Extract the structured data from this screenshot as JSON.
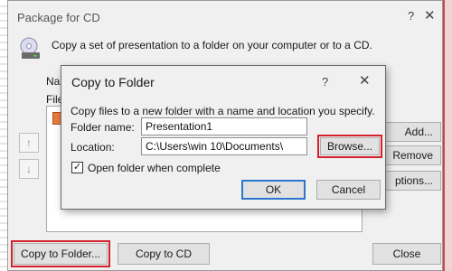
{
  "package_dialog": {
    "title": "Package for CD",
    "help": "?",
    "close": "✕",
    "description": "Copy a set of presentation to a folder on your computer or to a CD.",
    "name_label": "Nam",
    "files_label": "File",
    "up_arrow": "↑",
    "down_arrow": "↓",
    "add_label": "Add...",
    "remove_label": "Remove",
    "options_label": "ptions...",
    "copy_to_folder_label": "Copy to Folder...",
    "copy_to_cd_label": "Copy to CD",
    "close_label": "Close"
  },
  "copy_to_folder_dialog": {
    "title": "Copy to Folder",
    "help": "?",
    "close": "✕",
    "description": "Copy files to a new folder with a name and location you specify.",
    "folder_name_label": "Folder name:",
    "folder_name_value": "Presentation1",
    "location_label": "Location:",
    "location_value": "C:\\Users\\win 10\\Documents\\",
    "browse_label": "Browse...",
    "open_folder_checked": true,
    "check_mark": "✓",
    "open_folder_label": "Open folder when complete",
    "ok_label": "OK",
    "cancel_label": "Cancel"
  },
  "colors": {
    "highlight": "#d4202a",
    "default_button_border": "#2a75d0",
    "desktop": "#c94a4a"
  }
}
